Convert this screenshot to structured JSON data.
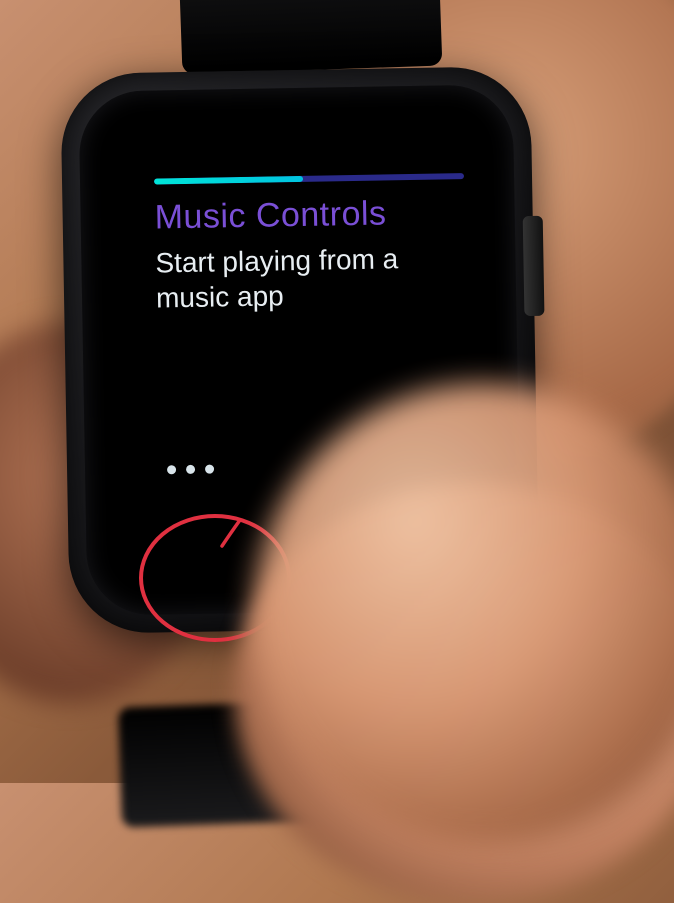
{
  "screen": {
    "title": "Music Controls",
    "subtitle_line1": "Start playing from a",
    "subtitle_line2": "music app",
    "progress_percent": 48,
    "page_dots": 3
  },
  "colors": {
    "title": "#7a4fd6",
    "progress_fill_start": "#00e5d8",
    "progress_track": "#2a2a8a",
    "annotation": "#e03040"
  }
}
